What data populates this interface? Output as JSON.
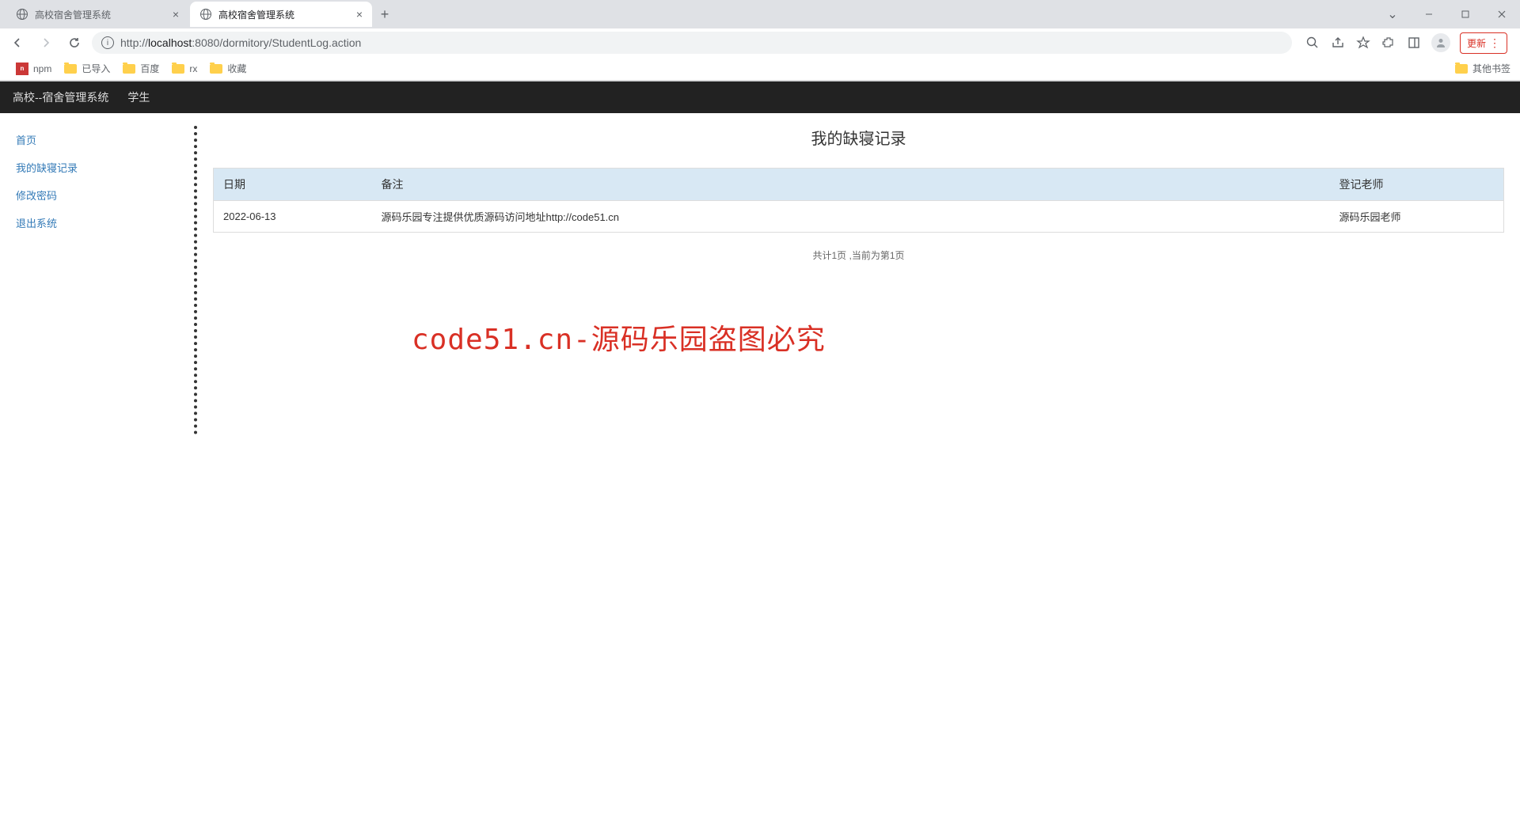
{
  "browser": {
    "tabs": [
      {
        "title": "高校宿舍管理系统",
        "active": false
      },
      {
        "title": "高校宿舍管理系统",
        "active": true
      }
    ],
    "url_host": "localhost",
    "url_port": ":8080",
    "url_path": "/dormitory/StudentLog.action",
    "url_prefix": "http://",
    "update_label": "更新",
    "bookmarks": [
      {
        "label": "npm",
        "icon": "npm"
      },
      {
        "label": "已导入",
        "icon": "folder"
      },
      {
        "label": "百度",
        "icon": "folder"
      },
      {
        "label": "rx",
        "icon": "folder"
      },
      {
        "label": "收藏",
        "icon": "folder"
      }
    ],
    "other_bookmarks_label": "其他书签"
  },
  "app": {
    "header": {
      "title": "高校--宿舍管理系统",
      "user_label": "学生"
    },
    "sidebar": {
      "items": [
        {
          "label": "首页"
        },
        {
          "label": "我的缺寝记录"
        },
        {
          "label": "修改密码"
        },
        {
          "label": "退出系统"
        }
      ]
    },
    "main": {
      "page_title": "我的缺寝记录",
      "table": {
        "headers": {
          "date": "日期",
          "remark": "备注",
          "teacher": "登记老师"
        },
        "rows": [
          {
            "date": "2022-06-13",
            "remark": "源码乐园专注提供优质源码访问地址http://code51.cn",
            "teacher": "源码乐园老师"
          }
        ]
      },
      "pagination_text": "共计1页 ,当前为第1页"
    }
  },
  "watermark_text": "code51.cn-源码乐园盗图必究"
}
